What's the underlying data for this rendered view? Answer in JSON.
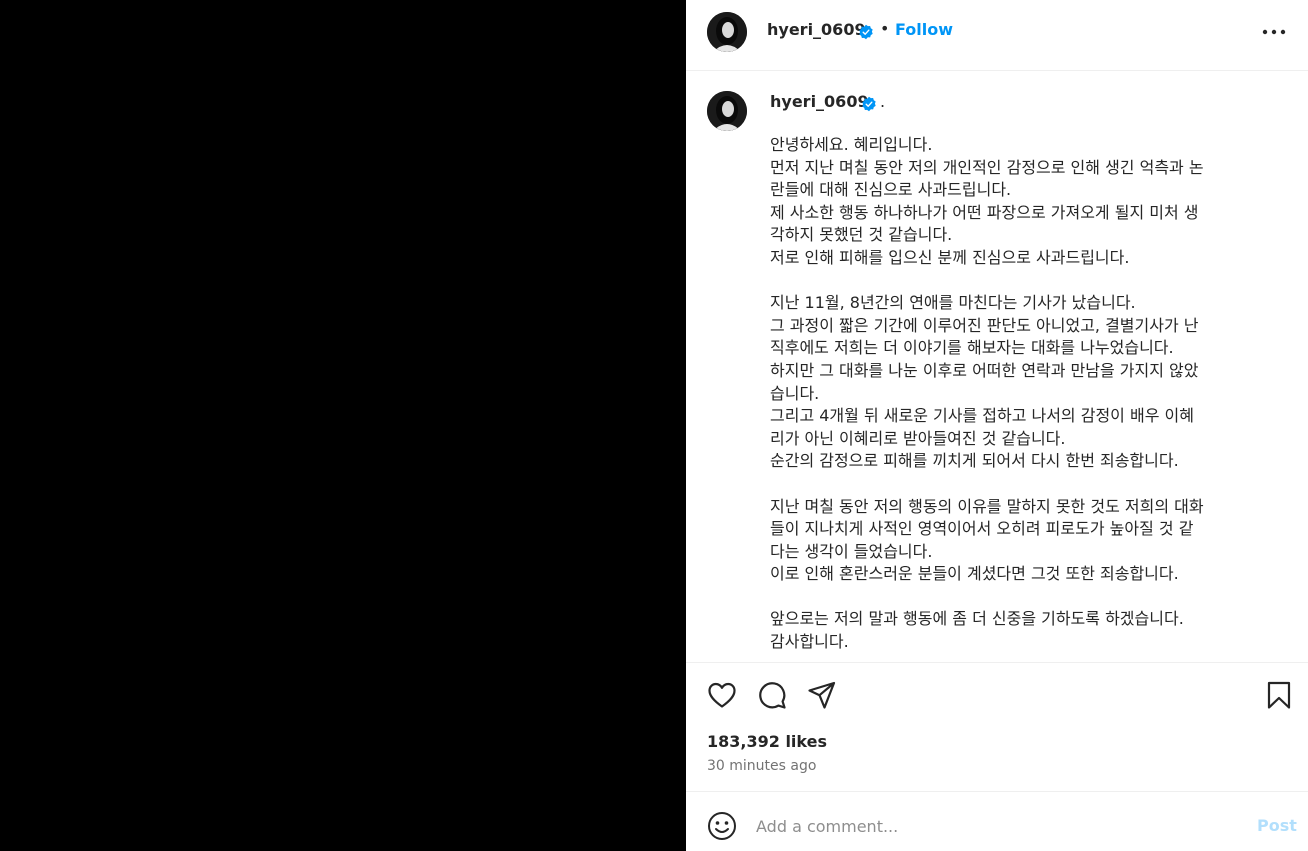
{
  "post": {
    "username": "hyeri_0609",
    "follow_label": "Follow",
    "separator": "•",
    "caption_tail": ".",
    "caption_lines": [
      "안녕하세요. 혜리입니다.",
      "먼저 지난 며칠 동안 저의 개인적인 감정으로 인해 생긴 억측과 논",
      "란들에 대해 진심으로 사과드립니다.",
      "제 사소한 행동 하나하나가 어떤 파장으로 가져오게 될지 미처 생",
      "각하지 못했던 것 같습니다.",
      "저로 인해 피해를 입으신 분께 진심으로 사과드립니다.",
      "",
      "지난 11월, 8년간의 연애를 마친다는 기사가 났습니다.",
      "그 과정이 짧은 기간에 이루어진 판단도 아니었고, 결별기사가 난",
      "직후에도 저희는 더 이야기를 해보자는 대화를 나누었습니다.",
      "하지만 그 대화를 나눈 이후로 어떠한 연락과 만남을 가지지 않았",
      "습니다.",
      "그리고 4개월 뒤 새로운 기사를 접하고 나서의 감정이 배우 이혜",
      "리가 아닌 이혜리로 받아들여진 것 같습니다.",
      "순간의 감정으로 피해를 끼치게 되어서 다시 한번 죄송합니다.",
      "",
      "지난 며칠 동안 저의 행동의 이유를 말하지 못한 것도 저희의 대화",
      "들이 지나치게 사적인 영역이어서 오히려 피로도가 높아질 것 같",
      "다는 생각이 들었습니다.",
      "이로 인해 혼란스러운 분들이 계셨다면 그것 또한 죄송합니다.",
      "",
      "앞으로는 저의 말과 행동에 좀 더 신중을 기하도록 하겠습니다.",
      "감사합니다."
    ],
    "likes": "183,392 likes",
    "time": "30 minutes ago"
  },
  "comment": {
    "placeholder": "Add a comment...",
    "post_label": "Post"
  },
  "icons": {
    "header": [
      "avatar",
      "verified-badge-icon",
      "more-options-icon"
    ],
    "actions": [
      "like-heart-icon",
      "comment-icon",
      "share-icon",
      "save-bookmark-icon"
    ],
    "comment": [
      "emoji-icon"
    ]
  },
  "colors": {
    "accent": "#0095f6",
    "post_disabled": "#b2dffc",
    "muted": "#737373",
    "media_background": "#000000"
  }
}
